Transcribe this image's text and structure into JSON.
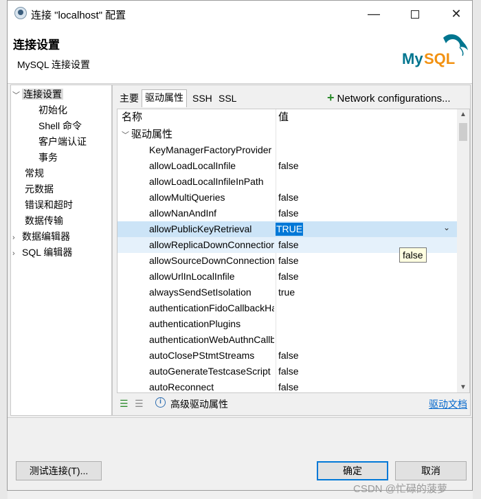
{
  "window": {
    "title": "连接 \"localhost\" 配置"
  },
  "header": {
    "title": "连接设置",
    "subtitle": "MySQL 连接设置",
    "logo_text": "MySQL"
  },
  "nav": {
    "items": [
      {
        "label": "连接设置",
        "expanded": true,
        "selected": true
      },
      {
        "label": "初始化",
        "child": true
      },
      {
        "label": "Shell 命令",
        "child": true
      },
      {
        "label": "客户端认证",
        "child": true
      },
      {
        "label": "事务",
        "child": true
      },
      {
        "label": "常规"
      },
      {
        "label": "元数据"
      },
      {
        "label": "错误和超时"
      },
      {
        "label": "数据传输"
      },
      {
        "label": "数据编辑器",
        "collapsed": true
      },
      {
        "label": "SQL 编辑器",
        "collapsed": true
      }
    ]
  },
  "tabs": [
    {
      "label": "主要"
    },
    {
      "label": "驱动属性",
      "active": true
    },
    {
      "label": "SSH"
    },
    {
      "label": "SSL"
    }
  ],
  "network_config": {
    "label": "Network configurations..."
  },
  "table": {
    "col_name": "名称",
    "col_value": "值",
    "group": "驱动属性",
    "rows": [
      {
        "name": "KeyManagerFactoryProvider",
        "value": ""
      },
      {
        "name": "allowLoadLocalInfile",
        "value": "false"
      },
      {
        "name": "allowLoadLocalInfileInPath",
        "value": ""
      },
      {
        "name": "allowMultiQueries",
        "value": "false"
      },
      {
        "name": "allowNanAndInf",
        "value": "false"
      },
      {
        "name": "allowPublicKeyRetrieval",
        "value": "TRUE"
      },
      {
        "name": "allowReplicaDownConnections",
        "value": "false"
      },
      {
        "name": "allowSourceDownConnections",
        "value": "false"
      },
      {
        "name": "allowUrlInLocalInfile",
        "value": "false"
      },
      {
        "name": "alwaysSendSetIsolation",
        "value": "true"
      },
      {
        "name": "authenticationFidoCallbackHandler",
        "value": ""
      },
      {
        "name": "authenticationPlugins",
        "value": ""
      },
      {
        "name": "authenticationWebAuthnCallbackHandler",
        "value": ""
      },
      {
        "name": "autoClosePStmtStreams",
        "value": "false"
      },
      {
        "name": "autoGenerateTestcaseScript",
        "value": "false"
      },
      {
        "name": "autoReconnect",
        "value": "false"
      }
    ],
    "selected_row": 5
  },
  "tooltip": {
    "text": "false"
  },
  "bottom": {
    "advanced_label": "高级驱动属性",
    "docs_link": "驱动文档"
  },
  "buttons": {
    "test": "测试连接(T)...",
    "ok": "确定",
    "cancel": "取消"
  },
  "watermark": "CSDN @忙碌的菠萝",
  "colors": {
    "selection": "#cce4f7",
    "edit_highlight": "#0078d7",
    "link": "#0066cc",
    "mysql_blue": "#00758f",
    "mysql_orange": "#f29111"
  }
}
